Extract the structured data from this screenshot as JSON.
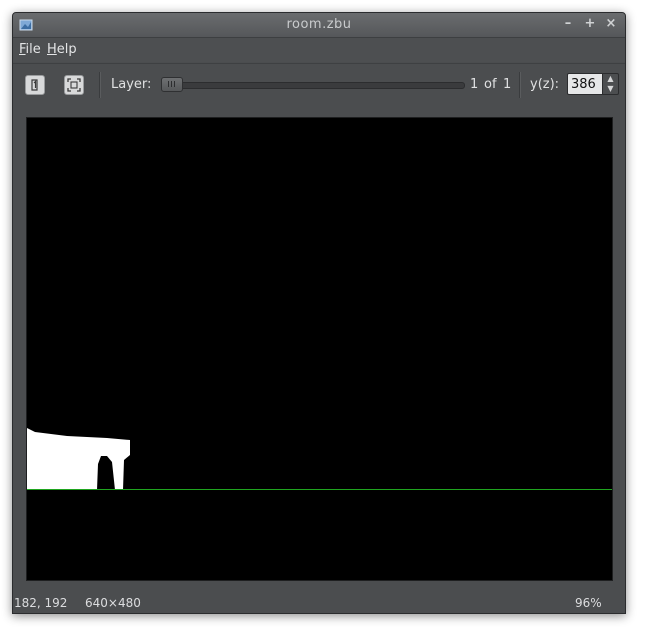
{
  "window": {
    "title": "room.zbu"
  },
  "menu": {
    "file_label": "File",
    "file_mnemonic": "F",
    "file_rest": "ile",
    "help_label": "Help",
    "help_mnemonic": "H",
    "help_rest": "elp"
  },
  "toolbar": {
    "open_icon": "open-file-icon",
    "fit_icon": "fit-to-window-icon",
    "layer_label": "Layer:",
    "layer_current": "1",
    "layer_of": "of",
    "layer_total": "1",
    "depth_label": "y(z):",
    "depth_value": "386"
  },
  "controls": {
    "minimize": "–",
    "maximize": "+",
    "close": "×"
  },
  "statusbar": {
    "cursor_position": "182, 192",
    "image_size": "640×480",
    "zoom": "96%"
  },
  "colors": {
    "scanline": "#1fa51f",
    "shape": "#ffffff",
    "background": "#000000"
  }
}
